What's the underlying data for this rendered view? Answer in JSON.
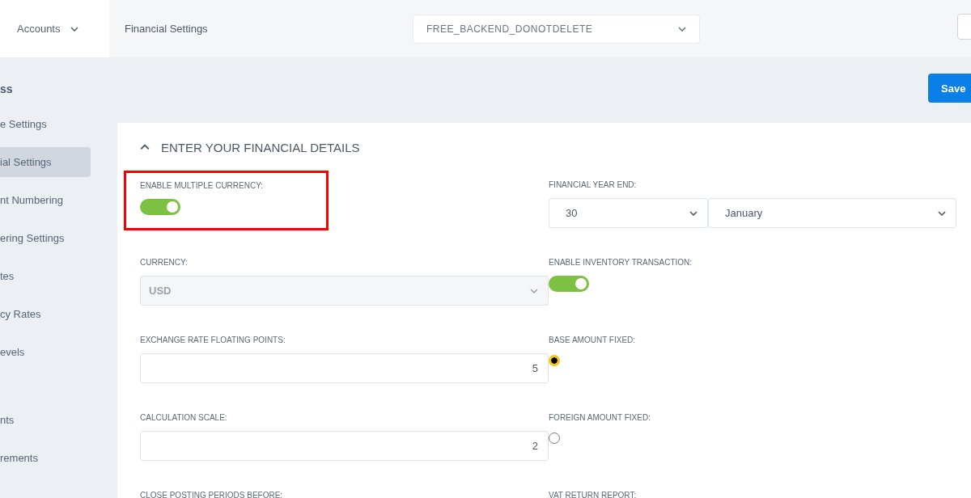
{
  "header": {
    "module": "Accounts",
    "page_title": "Financial Settings",
    "company_select": "FREE_BACKEND_DONOTDELETE"
  },
  "sidebar": {
    "title": "ss",
    "groups": [
      [
        {
          "label": "e Settings",
          "selected": false
        },
        {
          "label": "ial Settings",
          "selected": true
        },
        {
          "label": "nt Numbering",
          "selected": false
        },
        {
          "label": "ering Settings",
          "selected": false
        },
        {
          "label": "tes",
          "selected": false
        },
        {
          "label": "cy Rates",
          "selected": false
        },
        {
          "label": "evels",
          "selected": false
        }
      ],
      [
        {
          "label": "nts",
          "selected": false
        },
        {
          "label": "rements",
          "selected": false
        }
      ]
    ]
  },
  "save_button": "Save",
  "card": {
    "title": "ENTER YOUR FINANCIAL DETAILS",
    "expanded": true,
    "left_fields": [
      {
        "kind": "toggle",
        "label": "ENABLE MULTIPLE CURRENCY:",
        "on": true,
        "highlighted": true
      },
      {
        "kind": "select",
        "label": "CURRENCY:",
        "value": "USD",
        "disabled": true
      },
      {
        "kind": "number",
        "label": "EXCHANGE RATE FLOATING POINTS:",
        "value": "5"
      },
      {
        "kind": "number",
        "label": "CALCULATION SCALE:",
        "value": "2"
      },
      {
        "kind": "label",
        "label": "CLOSE POSTING PERIODS BEFORE:"
      }
    ],
    "right_fields": [
      {
        "kind": "select_pair",
        "label": "FINANCIAL YEAR END:",
        "values": [
          "30",
          "January"
        ]
      },
      {
        "kind": "toggle",
        "label": "ENABLE INVENTORY TRANSACTION:",
        "on": true
      },
      {
        "kind": "radio",
        "label": "BASE AMOUNT FIXED:",
        "selected": true
      },
      {
        "kind": "radio",
        "label": "FOREIGN AMOUNT FIXED:",
        "selected": false
      },
      {
        "kind": "label",
        "label": "VAT RETURN REPORT:"
      }
    ]
  }
}
